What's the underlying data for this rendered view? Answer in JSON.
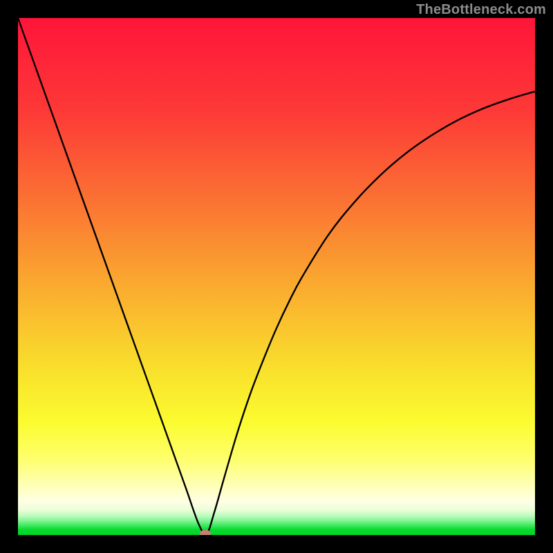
{
  "watermark": "TheBottleneck.com",
  "chart_data": {
    "type": "line",
    "title": "",
    "xlabel": "",
    "ylabel": "",
    "xlim": [
      0,
      100
    ],
    "ylim": [
      0,
      100
    ],
    "grid": false,
    "series": [
      {
        "name": "curve",
        "color": "#000000",
        "x": [
          0,
          2.5,
          5,
          7.5,
          10,
          12.5,
          15,
          17.5,
          20,
          22.5,
          25,
          27.5,
          30,
          32.5,
          35,
          36.5,
          38,
          40,
          42.5,
          45,
          47.5,
          50,
          52.5,
          55,
          60,
          65,
          70,
          75,
          80,
          85,
          90,
          95,
          100
        ],
        "y": [
          100,
          93,
          86,
          79,
          72,
          65,
          58,
          51,
          44,
          37,
          30,
          23,
          16,
          9,
          2,
          0.3,
          4.5,
          11.5,
          20,
          27.5,
          34,
          40,
          45.3,
          50,
          58,
          64.3,
          69.5,
          73.8,
          77.3,
          80.2,
          82.5,
          84.3,
          85.8
        ]
      }
    ],
    "marker": {
      "x": 36.2,
      "y": 0.3,
      "color": "#c97d78"
    },
    "gradient_stops": [
      {
        "pct": 0,
        "color": "#fe1539"
      },
      {
        "pct": 18,
        "color": "#fd3937"
      },
      {
        "pct": 35,
        "color": "#fb7133"
      },
      {
        "pct": 52,
        "color": "#faab2f"
      },
      {
        "pct": 68,
        "color": "#f9e02c"
      },
      {
        "pct": 78,
        "color": "#fbfb2f"
      },
      {
        "pct": 85,
        "color": "#feff69"
      },
      {
        "pct": 90,
        "color": "#feffb0"
      },
      {
        "pct": 93.5,
        "color": "#feffe4"
      },
      {
        "pct": 95.2,
        "color": "#eafed7"
      },
      {
        "pct": 96.4,
        "color": "#b7fbba"
      },
      {
        "pct": 97.3,
        "color": "#7ef490"
      },
      {
        "pct": 98.2,
        "color": "#3ce75c"
      },
      {
        "pct": 99.0,
        "color": "#06da2d"
      },
      {
        "pct": 100,
        "color": "#00d525"
      }
    ]
  }
}
